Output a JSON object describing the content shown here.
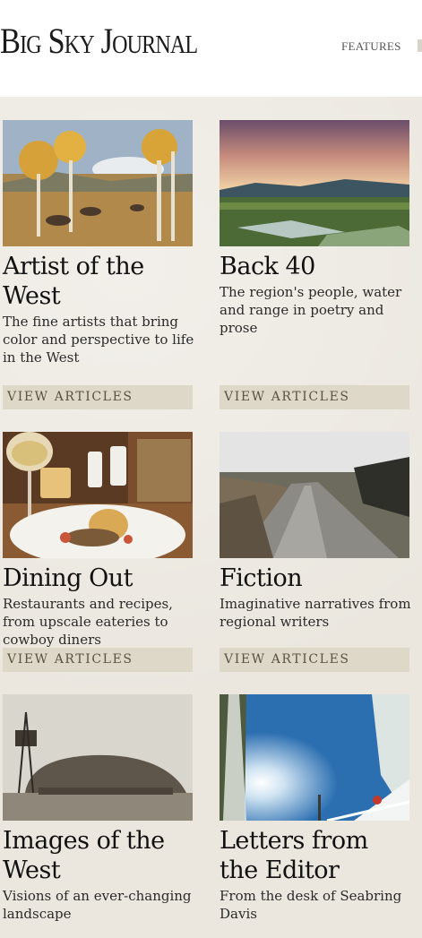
{
  "site": {
    "logo_text": "Big Sky Journal",
    "nav": {
      "features_label": "FEATURES"
    }
  },
  "cards": [
    {
      "title": "Artist of the West",
      "description": "The fine artists that bring color and perspective to life in the West",
      "button_label": "VIEW ARTICLES"
    },
    {
      "title": "Back 40",
      "description": "The region's people, water and range in poetry and prose",
      "button_label": "VIEW ARTICLES"
    },
    {
      "title": "Dining Out",
      "description": "Restaurants and recipes, from upscale eateries to cowboy diners",
      "button_label": "VIEW ARTICLES"
    },
    {
      "title": "Fiction",
      "description": "Imaginative narratives from regional writers",
      "button_label": "VIEW ARTICLES"
    },
    {
      "title": "Images of the West",
      "description": "Visions of an ever-changing landscape",
      "button_label": ""
    },
    {
      "title": "Letters from the Editor",
      "description": "From the desk of Seabring Davis",
      "button_label": ""
    }
  ]
}
